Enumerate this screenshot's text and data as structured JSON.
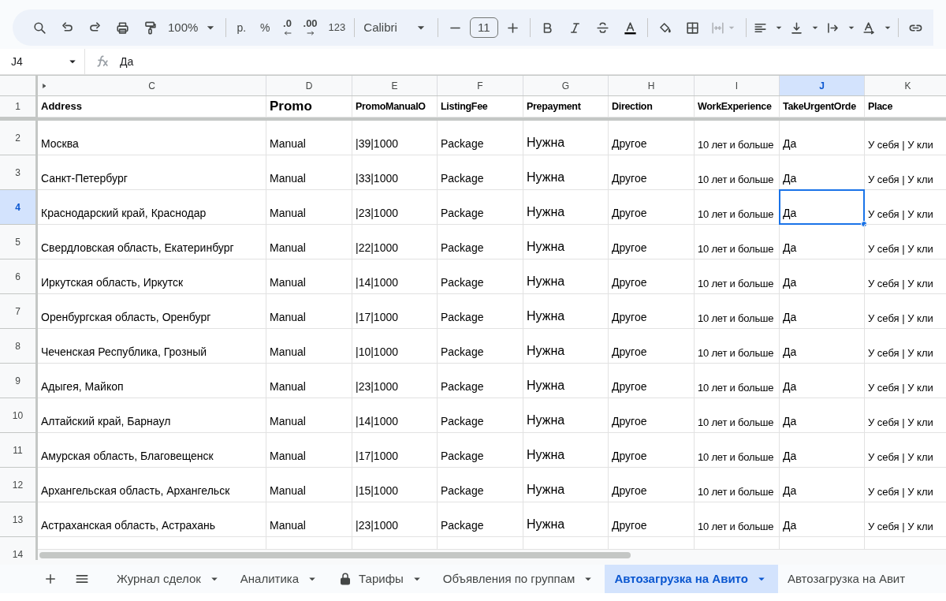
{
  "toolbar": {
    "zoom": "100%",
    "currency": "р.",
    "percent": "%",
    "decrease_decimals": ".0",
    "increase_decimals": ".00",
    "number_format": "123",
    "font": "Calibri",
    "font_size": "11"
  },
  "formula_bar": {
    "cell_ref": "J4",
    "formula": "Да"
  },
  "columns": [
    {
      "letter": "C",
      "selected": false
    },
    {
      "letter": "D",
      "selected": false
    },
    {
      "letter": "E",
      "selected": false
    },
    {
      "letter": "F",
      "selected": false
    },
    {
      "letter": "G",
      "selected": false
    },
    {
      "letter": "H",
      "selected": false
    },
    {
      "letter": "I",
      "selected": false
    },
    {
      "letter": "J",
      "selected": true
    },
    {
      "letter": "K",
      "selected": false
    }
  ],
  "header_row": {
    "number": "1",
    "cells": [
      "Address",
      "Promo",
      "PromoManualO",
      "ListingFee",
      "Prepayment",
      "Direction",
      "WorkExperience",
      "TakeUrgentOrde",
      "Place"
    ]
  },
  "rows": [
    {
      "number": "2",
      "selected": false,
      "cells": [
        "Москва",
        "Manual",
        "|39|1000",
        "Package",
        "Нужна",
        "Другое",
        "10 лет и больше",
        "Да",
        "У себя | У кли"
      ]
    },
    {
      "number": "3",
      "selected": false,
      "cells": [
        "Санкт-Петербург",
        "Manual",
        "|33|1000",
        "Package",
        "Нужна",
        "Другое",
        "10 лет и больше",
        "Да",
        "У себя | У кли"
      ]
    },
    {
      "number": "4",
      "selected": true,
      "cells": [
        "Краснодарский край, Краснодар",
        "Manual",
        "|23|1000",
        "Package",
        "Нужна",
        "Другое",
        "10 лет и больше",
        "Да",
        "У себя | У кли"
      ]
    },
    {
      "number": "5",
      "selected": false,
      "cells": [
        "Свердловская область, Екатеринбург",
        "Manual",
        "|22|1000",
        "Package",
        "Нужна",
        "Другое",
        "10 лет и больше",
        "Да",
        "У себя | У кли"
      ]
    },
    {
      "number": "6",
      "selected": false,
      "cells": [
        "Иркутская область, Иркутск",
        "Manual",
        "|14|1000",
        "Package",
        "Нужна",
        "Другое",
        "10 лет и больше",
        "Да",
        "У себя | У кли"
      ]
    },
    {
      "number": "7",
      "selected": false,
      "cells": [
        "Оренбургская область, Оренбург",
        "Manual",
        "|17|1000",
        "Package",
        "Нужна",
        "Другое",
        "10 лет и больше",
        "Да",
        "У себя | У кли"
      ]
    },
    {
      "number": "8",
      "selected": false,
      "cells": [
        "Чеченская Республика, Грозный",
        "Manual",
        "|10|1000",
        "Package",
        "Нужна",
        "Другое",
        "10 лет и больше",
        "Да",
        "У себя | У кли"
      ]
    },
    {
      "number": "9",
      "selected": false,
      "cells": [
        "Адыгея, Майкоп",
        "Manual",
        "|23|1000",
        "Package",
        "Нужна",
        "Другое",
        "10 лет и больше",
        "Да",
        "У себя | У кли"
      ]
    },
    {
      "number": "10",
      "selected": false,
      "cells": [
        "Алтайский край, Барнаул",
        "Manual",
        "|14|1000",
        "Package",
        "Нужна",
        "Другое",
        "10 лет и больше",
        "Да",
        "У себя | У кли"
      ]
    },
    {
      "number": "11",
      "selected": false,
      "cells": [
        "Амурская область, Благовещенск",
        "Manual",
        "|17|1000",
        "Package",
        "Нужна",
        "Другое",
        "10 лет и больше",
        "Да",
        "У себя | У кли"
      ]
    },
    {
      "number": "12",
      "selected": false,
      "cells": [
        "Архангельская область, Архангельск",
        "Manual",
        "|15|1000",
        "Package",
        "Нужна",
        "Другое",
        "10 лет и больше",
        "Да",
        "У себя | У кли"
      ]
    },
    {
      "number": "13",
      "selected": false,
      "cells": [
        "Астраханская область, Астрахань",
        "Manual",
        "|23|1000",
        "Package",
        "Нужна",
        "Другое",
        "10 лет и больше",
        "Да",
        "У себя | У кли"
      ]
    },
    {
      "number": "14",
      "selected": false
    }
  ],
  "sheet_tabs": [
    {
      "label": "Журнал сделок",
      "selected": false,
      "locked": false
    },
    {
      "label": "Аналитика",
      "selected": false,
      "locked": false
    },
    {
      "label": "Тарифы",
      "selected": false,
      "locked": true
    },
    {
      "label": "Объявления по группам",
      "selected": false,
      "locked": false
    },
    {
      "label": "Автозагрузка на Авито",
      "selected": true,
      "locked": false
    },
    {
      "label": "Автозагрузка на Авит",
      "selected": false,
      "locked": false
    }
  ]
}
